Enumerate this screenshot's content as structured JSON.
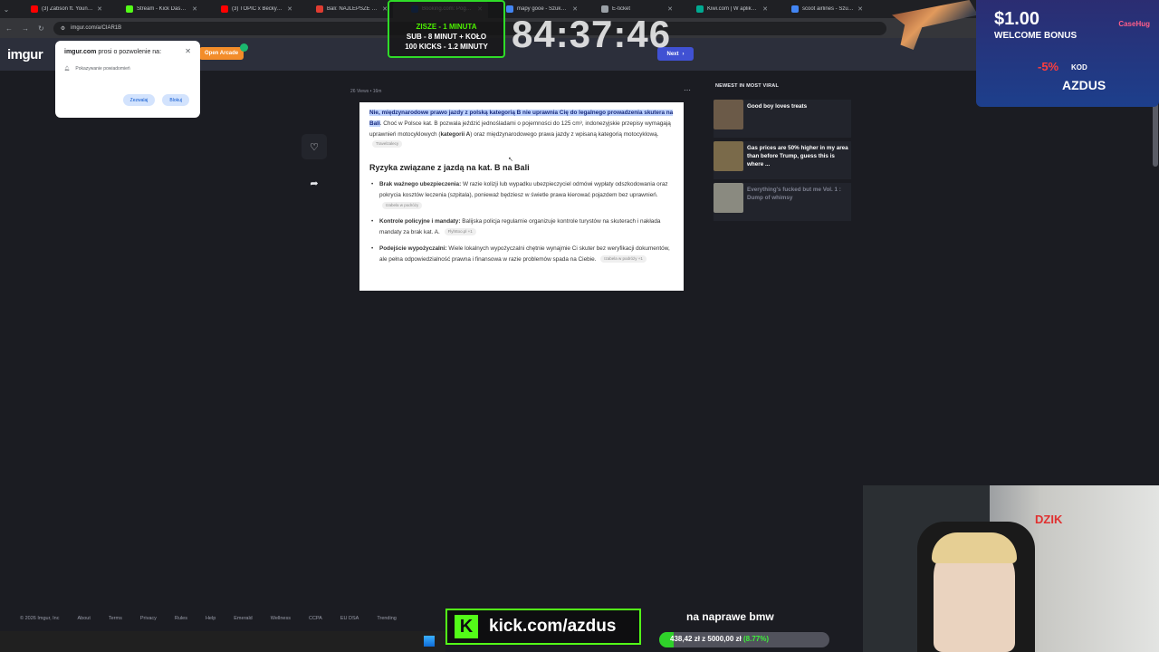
{
  "browser": {
    "tabs": [
      {
        "label": "(3) Zabson ft. Young Multi",
        "color": "#ff0000"
      },
      {
        "label": "Stream - Kick Dashboard",
        "color": "#53fc18"
      },
      {
        "label": "(3) TOPIC x Becky G - Sor",
        "color": "#ff0000"
      },
      {
        "label": "Bali: NAJLEPSZE wycieczk",
        "color": "#e03c31"
      },
      {
        "label": "Booking.com: Pogotowie",
        "color": "#003b95"
      },
      {
        "label": "mapy gooe - Szukaj w Go",
        "color": "#4285f4"
      },
      {
        "label": "E-ticket",
        "color": "#9aa0a6"
      },
      {
        "label": "Kiwi.com | W aplikacji jest",
        "color": "#00a991"
      },
      {
        "label": "scoot airlines - Szukaj w Go",
        "color": "#4285f4"
      }
    ],
    "url": "imgur.com/a/CIAR1B"
  },
  "site": {
    "logo": "imgur",
    "arcade_label": "Open Arcade",
    "next_label": "Next"
  },
  "permission": {
    "site": "imgur.com",
    "title_rest": "prosi o pozwolenie na:",
    "permission": "Pokazywanie powiadomień",
    "allow": "Zezwalaj",
    "block": "Blokuj"
  },
  "post": {
    "meta": "26 Views • 16m",
    "highlight": "Nie, międzynarodowe prawo jazdy z polską kategorią B nie uprawnia Cię do legalnego prowadzenia skutera na Bali",
    "intro_rest": ". Choć w Polsce kat. B pozwala jeździć jednośladami o pojemności do 125 cm³, indonezyjskie przepisy wymagają uprawnień motocyklowych (",
    "intro_bold": "kategorii A",
    "intro_end": ") oraz międzynarodowego prawa jazdy z wpisaną kategorią motocyklową.",
    "intro_chip": "Travelzalecy",
    "heading": "Ryzyka związane z jazdą na kat. B na Bali",
    "bullets": [
      {
        "title": "Brak ważnego ubezpieczenia:",
        "text": "W razie kolizji lub wypadku ubezpieczyciel odmówi wypłaty odszkodowania oraz pokrycia kosztów leczenia (szpitala), ponieważ będziesz w świetle prawa kierować pojazdem bez uprawnień.",
        "chip": "Izabela w podróży"
      },
      {
        "title": "Kontrole policyjne i mandaty:",
        "text": "Balijska policja regularnie organizuje kontrole turystów na skuterach i nakłada mandaty za brak kat. A.",
        "chip": "Flyhttoo.pl +1"
      },
      {
        "title": "Podejście wypożyczalni:",
        "text": "Wiele lokalnych wypożyczalni chętnie wynajmie Ci skuter bez weryfikacji dokumentów, ale pełna odpowiedzialność prawna i finansowa w razie problemów spada na Ciebie.",
        "chip": "Izabela w podróży +1"
      }
    ]
  },
  "sidebar": {
    "title": "NEWEST IN MOST VIRAL",
    "items": [
      {
        "text": "Good boy loves treats",
        "thumb": "#6b5a48"
      },
      {
        "text": "Gas prices are 50% higher in my area than before Trump, guess this is where ...",
        "thumb": "#7a6a4a"
      },
      {
        "text": "Everything's fucked but me Vol. 1 : Dump of whimsy",
        "thumb": "#8a8a80"
      }
    ]
  },
  "overlay": {
    "timer_lines": [
      "ZISZE - 1 MINUTA",
      "SUB - 8 MINUT + KOŁO",
      "100 KICKS - 1.2 MINUTY"
    ],
    "clock": "84:37:46",
    "bonus": "$1.00",
    "bonus_sub": "WELCOME BONUS",
    "brand": "CaseHug",
    "discount": "-5%",
    "code_label": "KOD",
    "code": "AZDUS",
    "webcam_badge": "DZIK",
    "kick_url": "kick.com/azdus",
    "goal_title": "na naprawe bmw",
    "goal_current": "438,42 zł",
    "goal_sep": "z",
    "goal_target": "5000,00 zł",
    "goal_pct_label": "(8.77%)",
    "goal_pct": 8.77
  },
  "footer": {
    "links": [
      "© 2026 Imgur, Inc",
      "About",
      "Terms",
      "Privacy",
      "Rules",
      "Help",
      "Emerald",
      "Wellness",
      "CCPA",
      "EU DSA",
      "Trending"
    ]
  }
}
